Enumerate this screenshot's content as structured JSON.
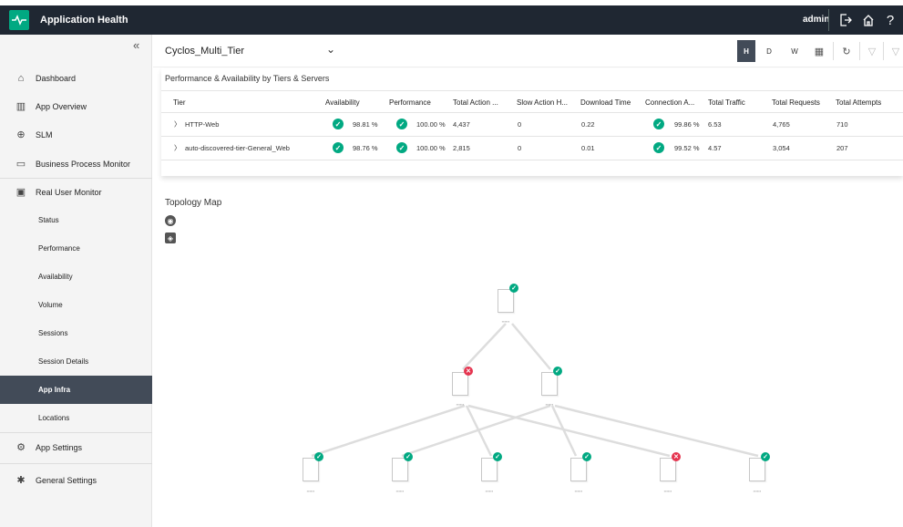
{
  "app": {
    "title": "Application Health",
    "user": "admin"
  },
  "sidebar": {
    "items": [
      {
        "label": "Dashboard",
        "icon": "home-icon"
      },
      {
        "label": "App Overview",
        "icon": "chart-icon"
      },
      {
        "label": "SLM",
        "icon": "slm-icon"
      },
      {
        "label": "Business Process Monitor",
        "icon": "monitor-icon"
      },
      {
        "label": "Real User Monitor",
        "icon": "rum-icon"
      }
    ],
    "sub_items": [
      {
        "label": "Status"
      },
      {
        "label": "Performance"
      },
      {
        "label": "Availability"
      },
      {
        "label": "Volume"
      },
      {
        "label": "Sessions"
      },
      {
        "label": "Session Details"
      },
      {
        "label": "App Infra",
        "active": true
      },
      {
        "label": "Locations"
      }
    ],
    "bottom_items": [
      {
        "label": "App Settings",
        "icon": "gear-icon"
      },
      {
        "label": "General Settings",
        "icon": "settings-icon"
      }
    ]
  },
  "selector": {
    "value": "Cyclos_Multi_Tier"
  },
  "time_range": {
    "options": [
      "H",
      "D",
      "W"
    ],
    "selected": "H"
  },
  "perf": {
    "title": "Performance & Availability by Tiers & Servers",
    "columns": [
      "Tier",
      "Availability",
      "Performance",
      "Total Action ...",
      "Slow Action H...",
      "Download Time",
      "Connection A...",
      "Total Traffic",
      "Total Requests",
      "Total Attempts"
    ],
    "rows": [
      {
        "tier": "HTTP-Web",
        "availability": "98.81 %",
        "performance": "100.00 %",
        "total_action": "4,437",
        "slow_action": "0",
        "download_time": "0.22",
        "connection": "99.86 %",
        "traffic": "6.53",
        "requests": "4,765",
        "attempts": "710"
      },
      {
        "tier": "auto-discovered-tier-General_Web",
        "availability": "98.76 %",
        "performance": "100.00 %",
        "total_action": "2,815",
        "slow_action": "0",
        "download_time": "0.01",
        "connection": "99.52 %",
        "traffic": "4.57",
        "requests": "3,054",
        "attempts": "207"
      }
    ]
  },
  "topology": {
    "title": "Topology Map",
    "colors": {
      "ok": "#01a982",
      "error": "#e5344f"
    },
    "nodes": [
      {
        "id": "n1",
        "status": "ok"
      },
      {
        "id": "n2",
        "status": "error"
      },
      {
        "id": "n3",
        "status": "ok"
      },
      {
        "id": "n4",
        "status": "ok"
      },
      {
        "id": "n5",
        "status": "ok"
      },
      {
        "id": "n6",
        "status": "ok"
      },
      {
        "id": "n7",
        "status": "ok"
      },
      {
        "id": "n8",
        "status": "error"
      },
      {
        "id": "n9",
        "status": "ok"
      }
    ]
  }
}
